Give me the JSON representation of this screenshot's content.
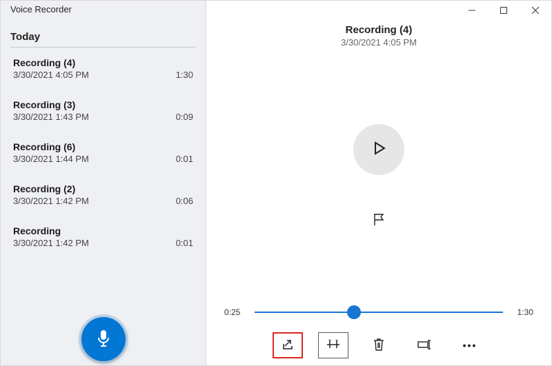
{
  "app_title": "Voice Recorder",
  "section_header": "Today",
  "recordings": [
    {
      "name": "Recording (4)",
      "datetime": "3/30/2021 4:05 PM",
      "duration": "1:30"
    },
    {
      "name": "Recording (3)",
      "datetime": "3/30/2021 1:43 PM",
      "duration": "0:09"
    },
    {
      "name": "Recording (6)",
      "datetime": "3/30/2021 1:44 PM",
      "duration": "0:01"
    },
    {
      "name": "Recording (2)",
      "datetime": "3/30/2021 1:42 PM",
      "duration": "0:06"
    },
    {
      "name": "Recording",
      "datetime": "3/30/2021 1:42 PM",
      "duration": "0:01"
    }
  ],
  "detail": {
    "title": "Recording (4)",
    "datetime": "3/30/2021 4:05 PM",
    "elapsed": "0:25",
    "total": "1:30",
    "progress_pct": 40
  },
  "window_controls": {
    "minimize": "Minimize",
    "maximize": "Maximize",
    "close": "Close"
  },
  "toolbar_labels": {
    "share": "Share",
    "trim": "Trim",
    "delete": "Delete",
    "rename": "Rename",
    "more": "More"
  }
}
